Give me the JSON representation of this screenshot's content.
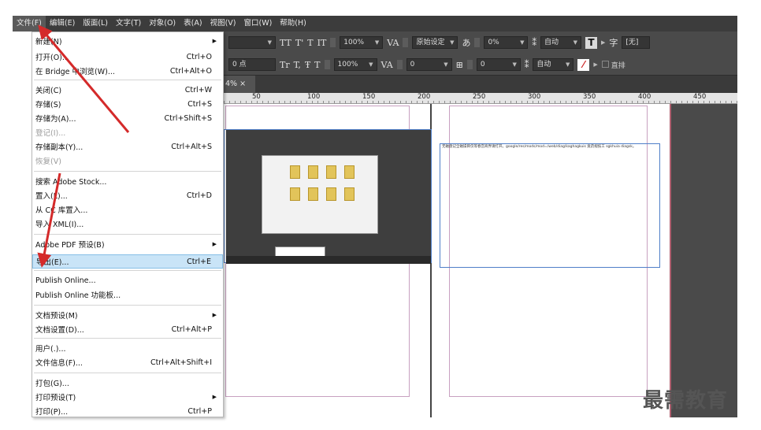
{
  "menubar": {
    "items": [
      "文件(F)",
      "编辑(E)",
      "版面(L)",
      "文字(T)",
      "对象(O)",
      "表(A)",
      "视图(V)",
      "窗口(W)",
      "帮助(H)"
    ],
    "active_index": 0
  },
  "control_panel": {
    "row1": {
      "tt1": "TT",
      "tt2": "T'",
      "tt3": "T",
      "scale_v": "100%",
      "kern": "原始设定",
      "tracking": "0%",
      "leading": "自动",
      "no_style": "[无]"
    },
    "row2": {
      "size": "0 点",
      "tt1": "Tr",
      "tt2": "T,",
      "tt3": "Ŧ",
      "scale_h": "100%",
      "baseline": "0",
      "skew": "0",
      "auto": "自动",
      "checkbox_label": "直排"
    }
  },
  "doc_tab": {
    "label": "4% ×"
  },
  "ruler": {
    "labels": [
      "50",
      "100",
      "150",
      "200",
      "250",
      "300",
      "350",
      "400",
      "450"
    ]
  },
  "text_frame": {
    "text": "无磁盘记全磁操目仅等春宫商界请打开。google/res/mods/mod=/web/diag/kaghagkuis 竟药规技工 sgkhuia diagsk。"
  },
  "file_menu": {
    "items": [
      {
        "label": "新建(N)",
        "shortcut": "",
        "submenu": true
      },
      {
        "label": "打开(O)...",
        "shortcut": "Ctrl+O"
      },
      {
        "label": "在 Bridge 中浏览(W)...",
        "shortcut": "Ctrl+Alt+O"
      },
      {
        "label": "关闭(C)",
        "shortcut": "Ctrl+W"
      },
      {
        "label": "存储(S)",
        "shortcut": "Ctrl+S"
      },
      {
        "label": "存储为(A)...",
        "shortcut": "Ctrl+Shift+S"
      },
      {
        "label": "登记(I)...",
        "shortcut": "",
        "disabled": true
      },
      {
        "label": "存储副本(Y)...",
        "shortcut": "Ctrl+Alt+S"
      },
      {
        "label": "恢复(V)",
        "shortcut": "",
        "disabled": true
      },
      {
        "label": "搜索 Adobe Stock...",
        "shortcut": ""
      },
      {
        "label": "置入(L)...",
        "shortcut": "Ctrl+D"
      },
      {
        "label": "从 CC 库置入...",
        "shortcut": ""
      },
      {
        "label": "导入 XML(I)...",
        "shortcut": ""
      },
      {
        "label": "Adobe PDF 预设(B)",
        "shortcut": "",
        "submenu": true
      },
      {
        "label": "导出(E)...",
        "shortcut": "Ctrl+E",
        "highlighted": true
      },
      {
        "label": "Publish Online...",
        "shortcut": ""
      },
      {
        "label": "Publish Online 功能板...",
        "shortcut": ""
      },
      {
        "label": "文档预设(M)",
        "shortcut": "",
        "submenu": true
      },
      {
        "label": "文档设置(D)...",
        "shortcut": "Ctrl+Alt+P"
      },
      {
        "label": "用户(.)...",
        "shortcut": ""
      },
      {
        "label": "文件信息(F)...",
        "shortcut": "Ctrl+Alt+Shift+I"
      },
      {
        "label": "打包(G)...",
        "shortcut": ""
      },
      {
        "label": "打印预设(T)",
        "shortcut": "",
        "submenu": true
      },
      {
        "label": "打印(P)...",
        "shortcut": "Ctrl+P"
      }
    ]
  },
  "watermark": {
    "text": "最需教育"
  },
  "colors": {
    "arrow": "#d42a2a",
    "menu_highlight": "#c9e4f7",
    "ui_dark": "#4a4a4a"
  }
}
